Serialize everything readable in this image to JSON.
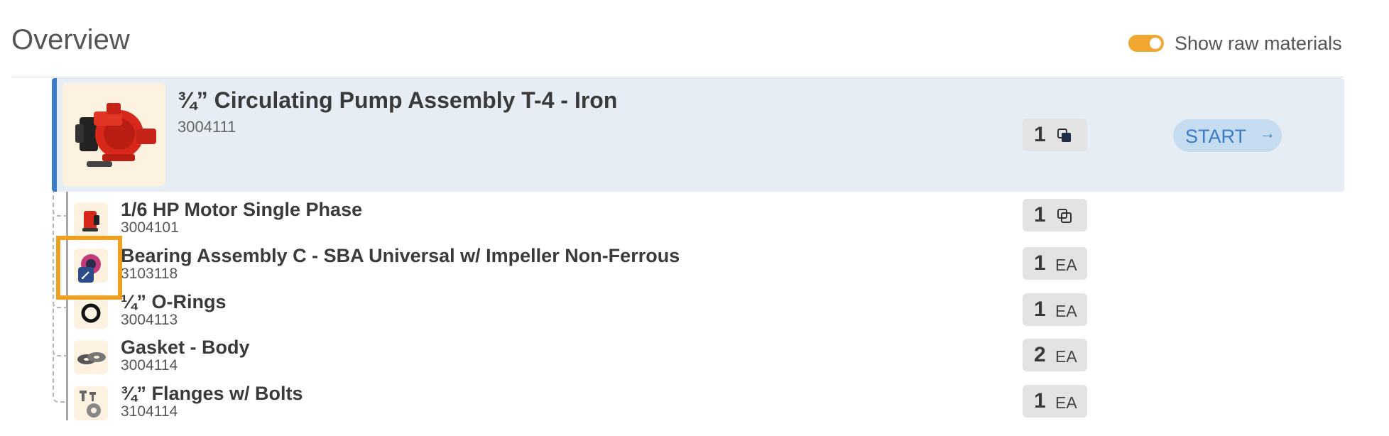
{
  "header": {
    "title": "Overview",
    "toggle_label": "Show raw materials",
    "toggle_on": true
  },
  "colors": {
    "accent": "#f0a830",
    "primary_blue": "#3a7bc8",
    "parent_row_bg": "#e6edf5",
    "thumb_bg": "#fdf1e0",
    "qty_pill_bg": "#e3e3e3"
  },
  "parent": {
    "name": "¾” Circulating Pump Assembly T-4 - Iron",
    "code": "3004111",
    "qty": "1",
    "qty_icon": "copy-stack-icon",
    "start_label": "START",
    "start_icon": "arrow-right-icon"
  },
  "children": [
    {
      "name": "1/6 HP Motor Single Phase",
      "code": "3004101",
      "qty": "1",
      "unit": "",
      "qty_icon": "copy-stack-icon",
      "thumb_icon": "motor-icon"
    },
    {
      "name": "Bearing Assembly C - SBA Universal w/ Impeller Non-Ferrous",
      "code": "3103118",
      "qty": "1",
      "unit": "EA",
      "thumb_icon": "bearing-icon"
    },
    {
      "name": "¼” O-Rings",
      "code": "3004113",
      "qty": "1",
      "unit": "EA",
      "thumb_icon": "o-ring-icon"
    },
    {
      "name": "Gasket - Body",
      "code": "3004114",
      "qty": "2",
      "unit": "EA",
      "thumb_icon": "gasket-icon"
    },
    {
      "name": "¾” Flanges w/ Bolts",
      "code": "3104114",
      "qty": "1",
      "unit": "EA",
      "thumb_icon": "flange-icon"
    }
  ]
}
